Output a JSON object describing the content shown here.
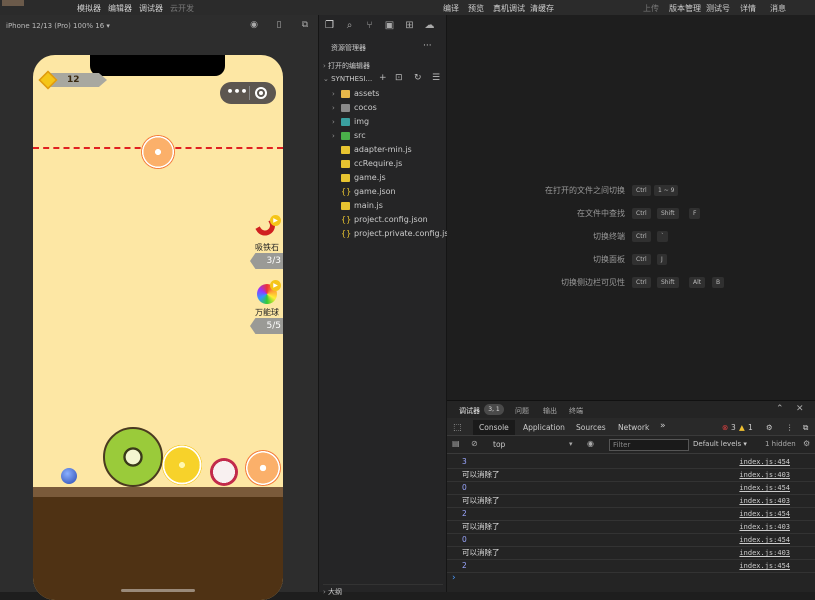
{
  "menubar": {
    "left": [
      "模拟器",
      "编辑器",
      "调试器",
      "云开发"
    ],
    "center": [
      "编译",
      "预览",
      "真机调试",
      "清缓存"
    ],
    "right": [
      "上传",
      "版本管理",
      "测试号",
      "详情",
      "消息"
    ]
  },
  "simulator": {
    "device": "iPhone 12/13 (Pro) 100% 16 ▾",
    "score": "12",
    "magnet": {
      "label": "吸铁石",
      "count": "3/3"
    },
    "rainbow": {
      "label": "万能球",
      "count": "5/5"
    }
  },
  "explorer": {
    "title": "资源管理器",
    "more": "···",
    "open_editors": "打开的编辑器",
    "project": "SYNTHESI...",
    "folders": [
      "assets",
      "cocos",
      "img",
      "src"
    ],
    "files": [
      {
        "name": "adapter-min.js",
        "icon": "js-file-icon"
      },
      {
        "name": "ccRequire.js",
        "icon": "js-file-icon"
      },
      {
        "name": "game.js",
        "icon": "js-file-icon"
      },
      {
        "name": "game.json",
        "icon": "json-file-icon"
      },
      {
        "name": "main.js",
        "icon": "js-file-icon"
      },
      {
        "name": "project.config.json",
        "icon": "json-file-icon"
      },
      {
        "name": "project.private.config.js...",
        "icon": "json-file-icon"
      }
    ],
    "outline": "大纲"
  },
  "shortcuts": [
    {
      "label": "在打开的文件之间切换",
      "keys": [
        "Ctrl",
        "1 ~ 9"
      ]
    },
    {
      "label": "在文件中查找",
      "keys": [
        "Ctrl",
        "Shift",
        "F"
      ]
    },
    {
      "label": "切换终端",
      "keys": [
        "Ctrl",
        "`"
      ]
    },
    {
      "label": "切换面板",
      "keys": [
        "Ctrl",
        "J"
      ]
    },
    {
      "label": "切换侧边栏可见性",
      "keys": [
        "Ctrl",
        "Shift",
        "Alt",
        "B"
      ]
    }
  ],
  "devtools": {
    "tabs": [
      "调试器",
      "问题",
      "输出",
      "终端"
    ],
    "badge": "3, 1",
    "console_tabs": [
      "Console",
      "Application",
      "Sources",
      "Network"
    ],
    "more_tabs": "»",
    "errors": "3",
    "warnings": "1",
    "context": "top",
    "filter_placeholder": "Filter",
    "levels": "Default levels ▾",
    "hidden": "1 hidden",
    "logs": [
      {
        "msg": "3",
        "type": "num",
        "src": "index.js:454"
      },
      {
        "msg": "可以消除了",
        "type": "text",
        "src": "index.js:403"
      },
      {
        "msg": "0",
        "type": "num",
        "src": "index.js:454"
      },
      {
        "msg": "可以消除了",
        "type": "text",
        "src": "index.js:403"
      },
      {
        "msg": "2",
        "type": "num",
        "src": "index.js:454"
      },
      {
        "msg": "可以消除了",
        "type": "text",
        "src": "index.js:403"
      },
      {
        "msg": "0",
        "type": "num",
        "src": "index.js:454"
      },
      {
        "msg": "可以消除了",
        "type": "text",
        "src": "index.js:403"
      },
      {
        "msg": "2",
        "type": "num",
        "src": "index.js:454"
      }
    ]
  }
}
